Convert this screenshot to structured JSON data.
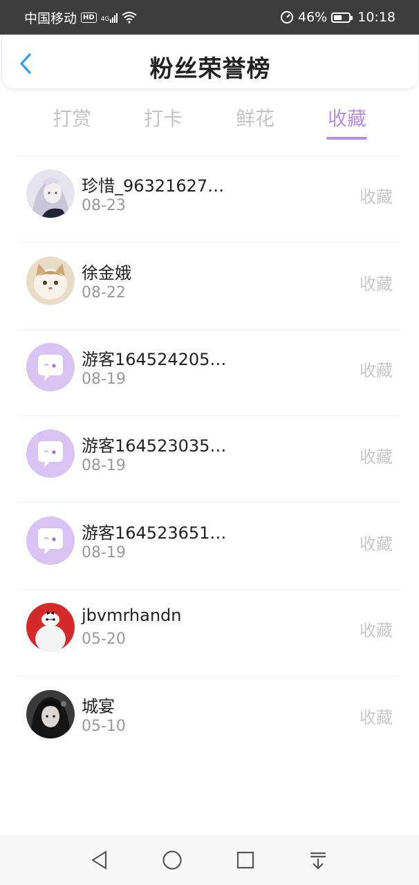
{
  "status_bar": {
    "carrier": "中国移动",
    "hd": "HD",
    "network": "4G",
    "battery": "46%",
    "time": "10:18"
  },
  "header": {
    "title": "粉丝荣誉榜",
    "back_icon": "chevron-left-icon"
  },
  "tabs": [
    {
      "label": "打赏",
      "active": false
    },
    {
      "label": "打卡",
      "active": false
    },
    {
      "label": "鲜花",
      "active": false
    },
    {
      "label": "收藏",
      "active": true
    }
  ],
  "accent_color": "#b68ee6",
  "fans": [
    {
      "name": "珍惜_96321627…",
      "date": "08-23",
      "action": "收藏",
      "avatar": "anime-girl-avatar"
    },
    {
      "name": "徐金娥",
      "date": "08-22",
      "action": "收藏",
      "avatar": "cat-avatar"
    },
    {
      "name": "游客164524205…",
      "date": "08-19",
      "action": "收藏",
      "avatar": "chat-bubble-avatar"
    },
    {
      "name": "游客164523035…",
      "date": "08-19",
      "action": "收藏",
      "avatar": "chat-bubble-avatar"
    },
    {
      "name": "游客164523651…",
      "date": "08-19",
      "action": "收藏",
      "avatar": "chat-bubble-avatar"
    },
    {
      "name": "jbvmrhandn",
      "date": "05-20",
      "action": "收藏",
      "avatar": "baymax-avatar"
    },
    {
      "name": "城宴",
      "date": "05-10",
      "action": "收藏",
      "avatar": "dark-anime-avatar"
    }
  ],
  "nav": [
    "back-triangle-icon",
    "home-circle-icon",
    "recents-square-icon",
    "notification-down-icon"
  ]
}
